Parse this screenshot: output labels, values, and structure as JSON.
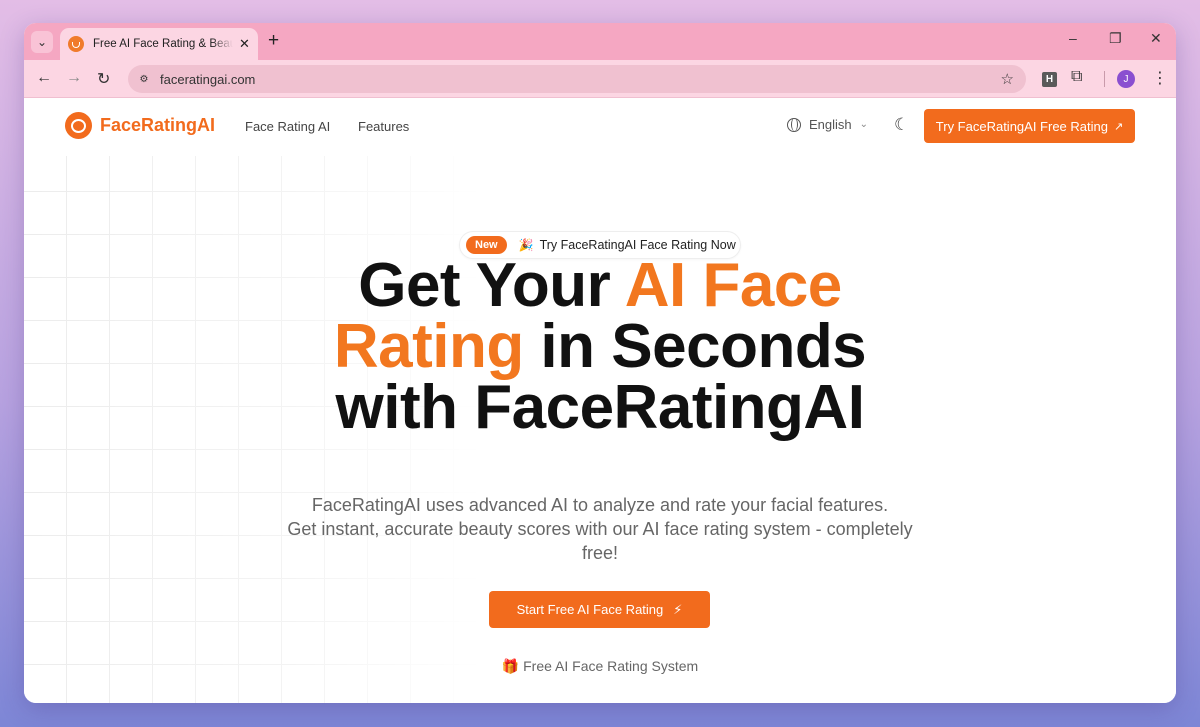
{
  "browser": {
    "tab_title": "Free AI Face Rating & Beauty Analysis",
    "tab_close": "✕",
    "new_tab": "+",
    "url": "faceratingai.com",
    "profile_initial": "J",
    "extension_h": "H",
    "window_controls": {
      "minimize": "–",
      "maximize": "❐",
      "close": "✕"
    }
  },
  "nav": {
    "brand": "FaceRatingAI",
    "links": [
      "Face Rating AI",
      "Features"
    ],
    "language": "English",
    "cta": "Try FaceRatingAI Free Rating",
    "cta_arrow": "↗"
  },
  "hero": {
    "badge": "New",
    "announcement_emoji": "🎉",
    "announcement": "Try FaceRatingAI Face Rating Now",
    "headline": {
      "part1": "Get Your ",
      "highlight1": "AI Face",
      "highlight2": "Rating",
      "part2": " in Seconds",
      "part3": "with FaceRatingAI"
    },
    "subtitle_line1": "FaceRatingAI uses advanced AI to analyze and rate your facial features.",
    "subtitle_line2": "Get instant, accurate beauty scores with our AI face rating system - completely",
    "subtitle_line3": "free!",
    "cta": "Start Free AI Face Rating",
    "cta_icon": "⚡",
    "free_emoji": "🎁",
    "free_text": "Free AI Face Rating System",
    "stars": "★★★★★"
  },
  "colors": {
    "brand_orange": "#f26b1d",
    "headline_orange": "#f2771f",
    "tabstrip": "#f5a7c2",
    "toolbar": "#fcd6e3",
    "star_yellow": "#f5c400"
  },
  "icons": [
    "tab-search-icon",
    "favicon-icon",
    "close-icon",
    "plus-icon",
    "back-icon",
    "forward-icon",
    "reload-icon",
    "site-info-icon",
    "bookmark-star-icon",
    "extensions-icon",
    "menu-icon",
    "logo-icon",
    "globe-icon",
    "chevron-down-icon",
    "moon-icon",
    "external-arrow-icon",
    "bolt-icon",
    "gift-icon",
    "star-icon"
  ]
}
